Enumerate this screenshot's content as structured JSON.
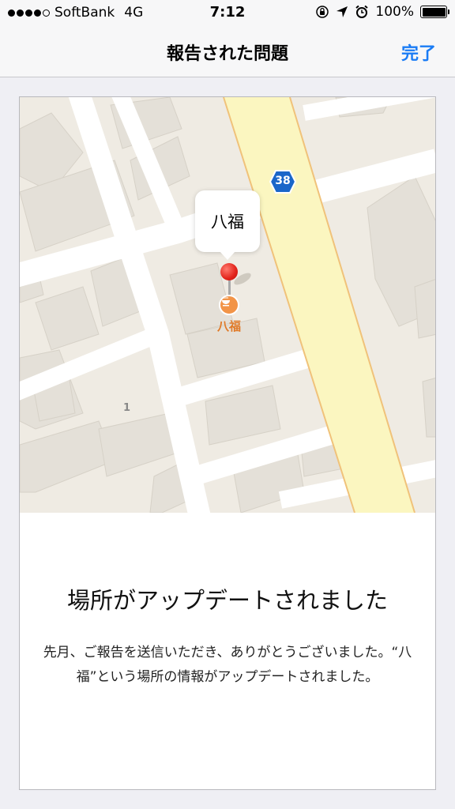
{
  "status_bar": {
    "carrier": "SoftBank",
    "network": "4G",
    "time": "7:12",
    "battery": "100%",
    "battery_level": 1.0
  },
  "nav": {
    "title": "報告された問題",
    "done_label": "完了"
  },
  "map": {
    "callout_label": "八福",
    "poi_label": "八福",
    "route_number": "38",
    "block_number": "1",
    "icons": [
      "red-pin-icon",
      "restaurant-icon",
      "route-shield-icon"
    ],
    "colors": {
      "road": "#ffffff",
      "highway": "#fbf6c0",
      "highway_edge": "#f0c27a",
      "ground": "#efebe3",
      "building": "#e4e0d8",
      "poi": "#f29447",
      "shield": "#1a66c9"
    }
  },
  "message": {
    "headline": "場所がアップデートされました",
    "body": "先月、ご報告を送信いただき、ありがとうございました。“八福”という場所の情報がアップデートされました。"
  },
  "colors": {
    "accent": "#1a7cf5",
    "background": "#efeff4"
  }
}
